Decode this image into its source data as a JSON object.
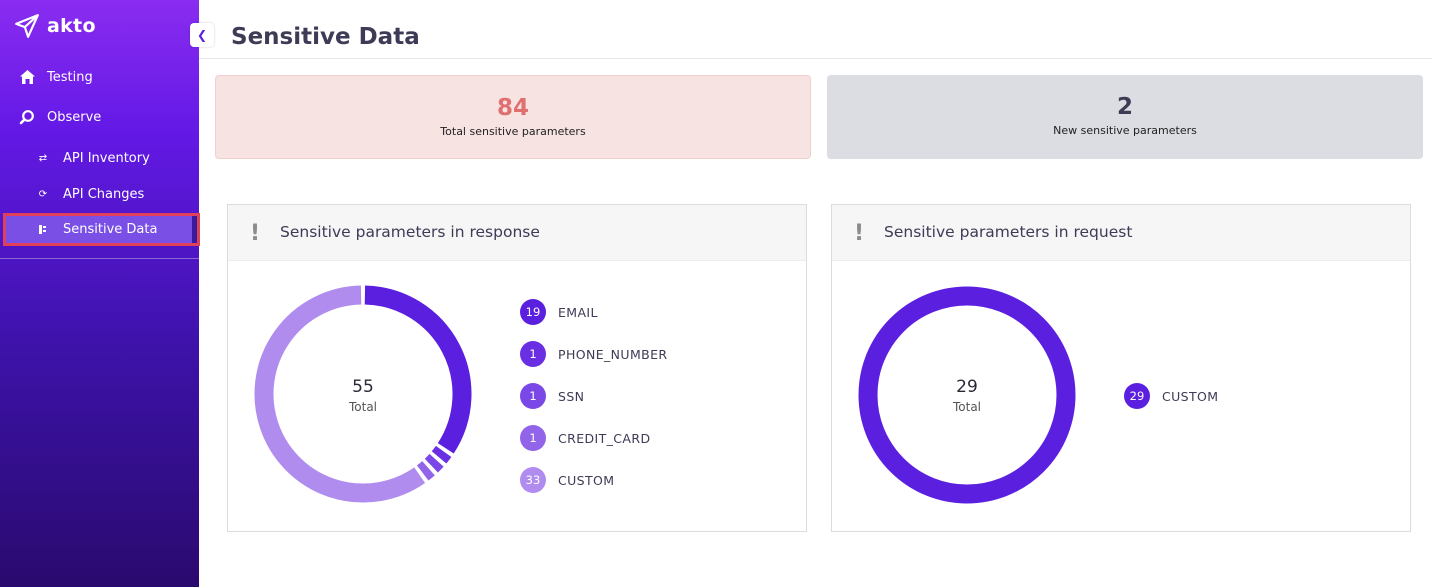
{
  "app": {
    "name": "akto"
  },
  "sidebar": {
    "items": [
      {
        "label": "Testing",
        "icon": "home-icon"
      },
      {
        "label": "Observe",
        "icon": "search-icon"
      },
      {
        "label": "API Inventory",
        "icon": "arrows-icon"
      },
      {
        "label": "API Changes",
        "icon": "refresh-icon"
      },
      {
        "label": "Sensitive Data",
        "icon": "data-icon",
        "active": true
      }
    ]
  },
  "page": {
    "title": "Sensitive Data"
  },
  "stats": {
    "total": {
      "value": "84",
      "label": "Total sensitive parameters",
      "color": "#e07070"
    },
    "new": {
      "value": "2",
      "label": "New sensitive parameters"
    }
  },
  "response_card": {
    "title": "Sensitive parameters in response",
    "total": "55",
    "total_label": "Total",
    "legend": [
      {
        "count": "19",
        "label": "EMAIL",
        "color": "#5b1fe0"
      },
      {
        "count": "1",
        "label": "PHONE_NUMBER",
        "color": "#6a2ee3"
      },
      {
        "count": "1",
        "label": "SSN",
        "color": "#7a48e6"
      },
      {
        "count": "1",
        "label": "CREDIT_CARD",
        "color": "#9264ea"
      },
      {
        "count": "33",
        "label": "CUSTOM",
        "color": "#b08cef"
      }
    ]
  },
  "request_card": {
    "title": "Sensitive parameters in request",
    "total": "29",
    "total_label": "Total",
    "legend": [
      {
        "count": "29",
        "label": "CUSTOM",
        "color": "#5b1fe0"
      }
    ]
  },
  "colors": {
    "accent": "#5b1fe0",
    "active_outline": "#e0405a"
  }
}
